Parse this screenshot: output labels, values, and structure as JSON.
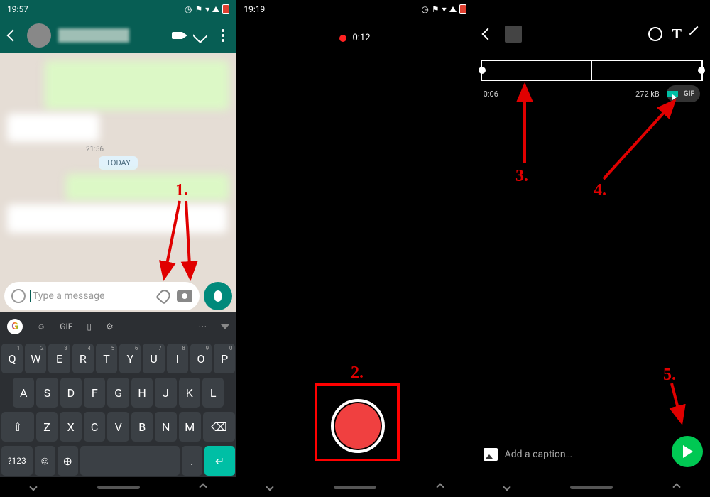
{
  "panel1": {
    "status_time": "19:57",
    "today_label": "TODAY",
    "msg_time": "21:56",
    "input_placeholder": "Type a message",
    "keyboard": {
      "gif": "GIF",
      "row1": [
        "Q",
        "W",
        "E",
        "R",
        "T",
        "Y",
        "U",
        "I",
        "O",
        "P"
      ],
      "row1_sup": [
        "1",
        "2",
        "3",
        "4",
        "5",
        "6",
        "7",
        "8",
        "9",
        "0"
      ],
      "row2": [
        "A",
        "S",
        "D",
        "F",
        "G",
        "H",
        "J",
        "K",
        "L"
      ],
      "row3": [
        "Z",
        "X",
        "C",
        "V",
        "B",
        "N",
        "M"
      ],
      "symbols": "?123",
      "comma": ",",
      "period": ".",
      "enter": "↵"
    }
  },
  "panel2": {
    "status_time": "19:19",
    "rec_time": "0:12"
  },
  "panel3": {
    "trim_time": "0:06",
    "file_size": "272 kB",
    "gif_label": "GIF",
    "caption_placeholder": "Add a caption…"
  },
  "annotations": {
    "a1": "1.",
    "a2": "2.",
    "a3": "3.",
    "a4": "4.",
    "a5": "5."
  }
}
